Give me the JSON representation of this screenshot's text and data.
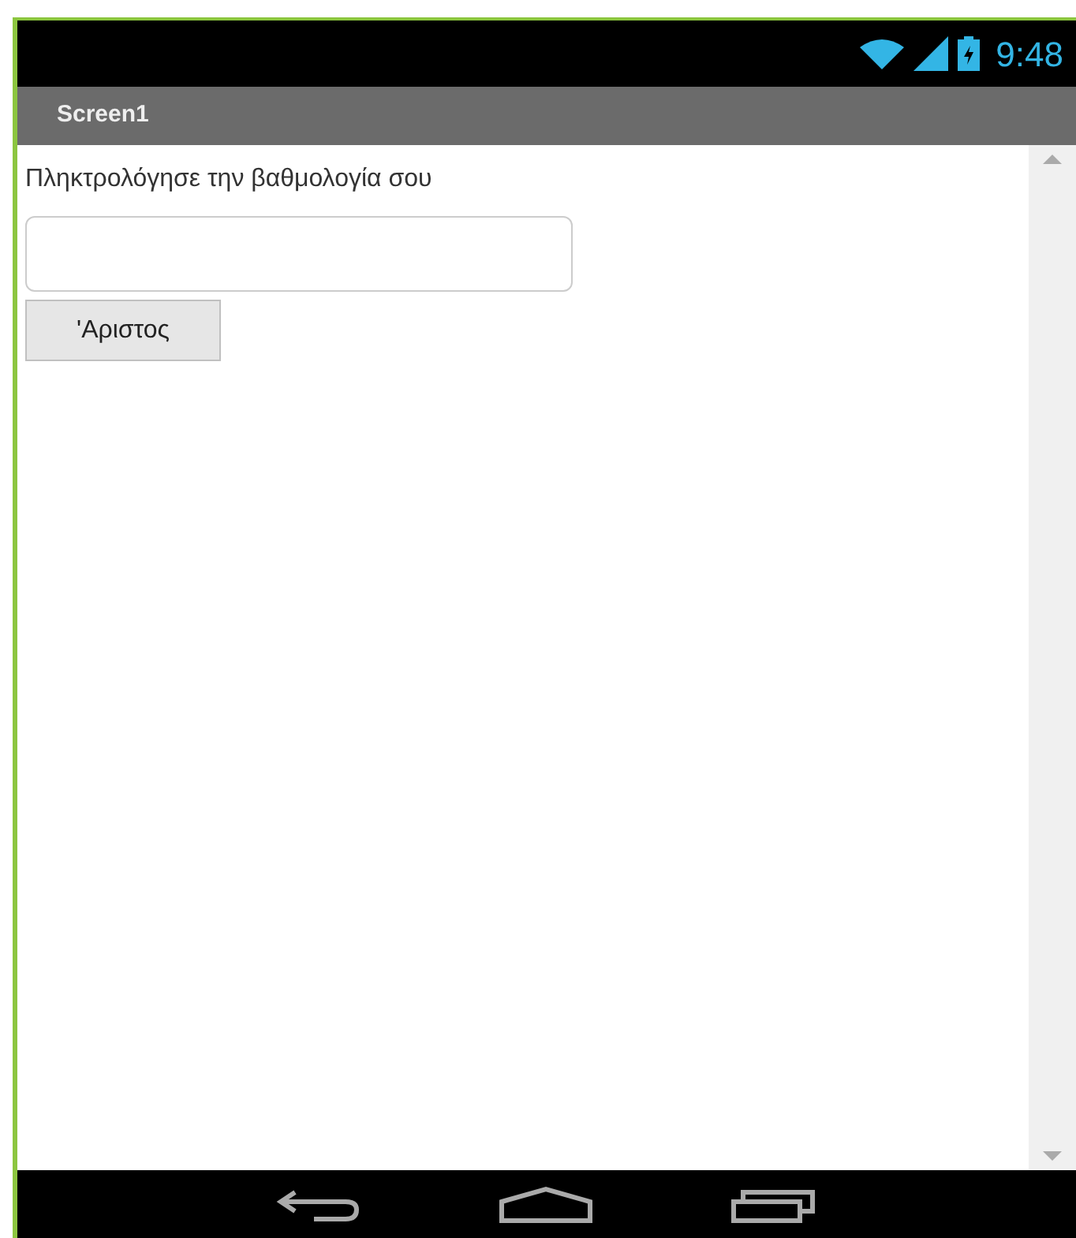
{
  "status_bar": {
    "time": "9:48"
  },
  "title_bar": {
    "title": "Screen1"
  },
  "content": {
    "label": "Πληκτρολόγησε την βαθμολογία σου",
    "button": {
      "label": "'Αριστος"
    }
  }
}
